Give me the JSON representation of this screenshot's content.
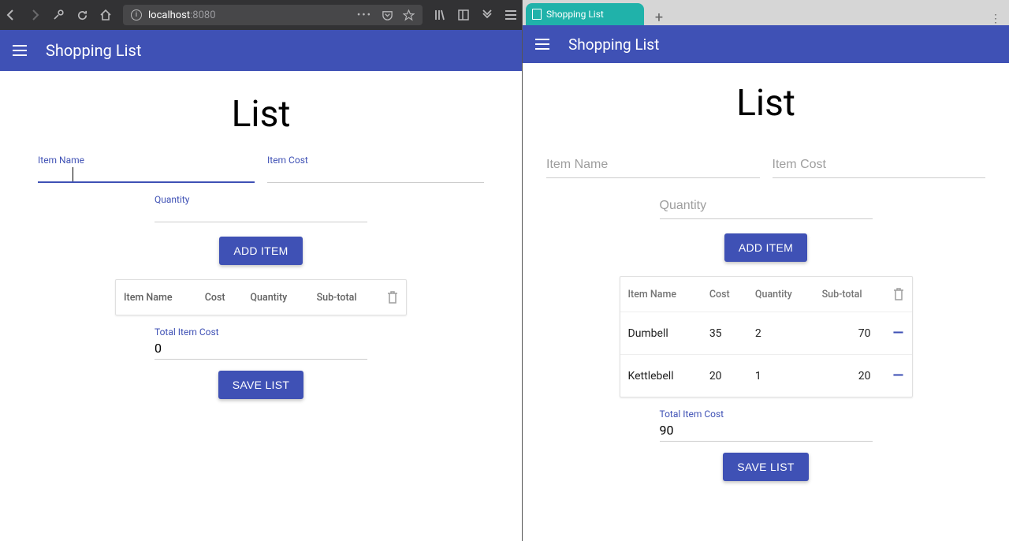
{
  "browser": {
    "url_host": "localhost",
    "url_port": ":8080",
    "tab_title_right": "Shopping List"
  },
  "app": {
    "title": "Shopping List"
  },
  "left": {
    "heading": "List",
    "item_name_label": "Item Name",
    "item_cost_label": "Item Cost",
    "quantity_label": "Quantity",
    "add_item_btn": "ADD ITEM",
    "save_list_btn": "SAVE LIST",
    "table_headers": {
      "name": "Item Name",
      "cost": "Cost",
      "qty": "Quantity",
      "sub": "Sub-total"
    },
    "total_label": "Total Item Cost",
    "total_value": "0",
    "rows": []
  },
  "right": {
    "heading": "List",
    "item_name_ph": "Item Name",
    "item_cost_ph": "Item Cost",
    "quantity_ph": "Quantity",
    "add_item_btn": "ADD ITEM",
    "save_list_btn": "SAVE LIST",
    "table_headers": {
      "name": "Item Name",
      "cost": "Cost",
      "qty": "Quantity",
      "sub": "Sub-total"
    },
    "total_label": "Total Item Cost",
    "total_value": "90",
    "rows": [
      {
        "name": "Dumbell",
        "cost": "35",
        "qty": "2",
        "sub": "70"
      },
      {
        "name": "Kettlebell",
        "cost": "20",
        "qty": "1",
        "sub": "20"
      }
    ]
  }
}
